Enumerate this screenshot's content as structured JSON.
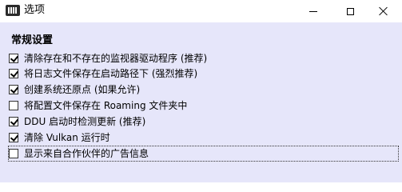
{
  "window": {
    "title": "选项"
  },
  "section": {
    "title": "常规设置"
  },
  "options": [
    {
      "label": "清除存在和不存在的监视器驱动程序 (推荐)",
      "checked": true
    },
    {
      "label": "将日志文件保存在启动路径下 (强烈推荐)",
      "checked": true
    },
    {
      "label": "创建系统还原点 (如果允许)",
      "checked": true
    },
    {
      "label": "将配置文件保存在 Roaming 文件夹中",
      "checked": false
    },
    {
      "label": "DDU 启动时检测更新 (推荐)",
      "checked": true
    },
    {
      "label": "清除 Vulkan 运行时",
      "checked": true
    },
    {
      "label": "显示来自合作伙伴的广告信息",
      "checked": false
    }
  ]
}
